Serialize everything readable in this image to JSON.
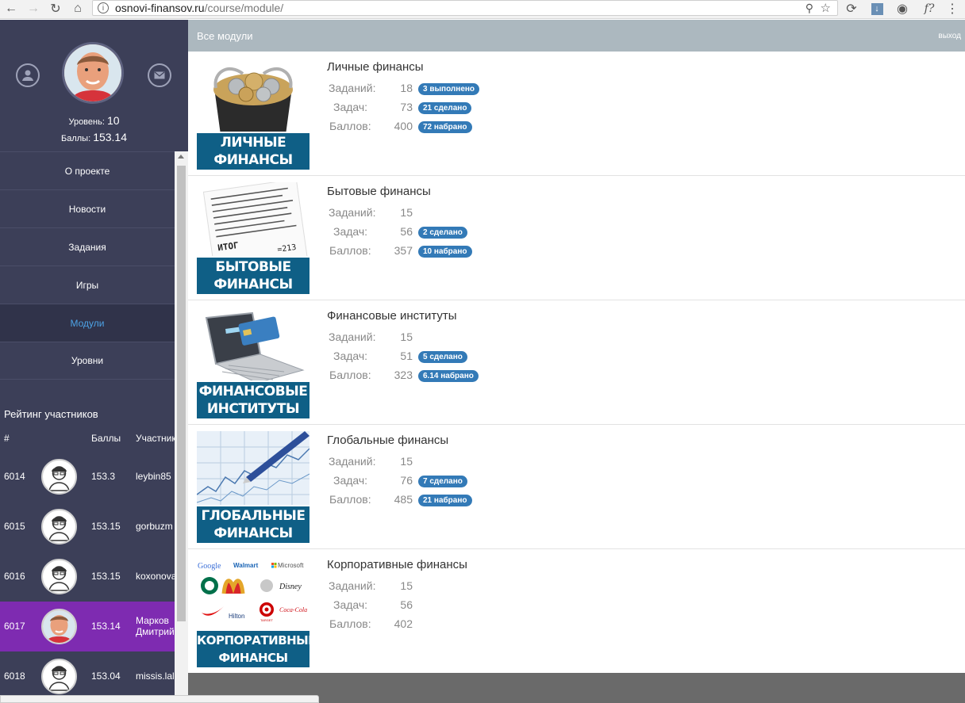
{
  "browser": {
    "url_host": "osnovi-finansov.ru",
    "url_path": "/course/module/",
    "ext_label": "f?"
  },
  "sidebar": {
    "level_label": "Уровень:",
    "level_value": "10",
    "points_label": "Баллы:",
    "points_value": "153.14",
    "menu": [
      {
        "label": "О проекте"
      },
      {
        "label": "Новости"
      },
      {
        "label": "Задания"
      },
      {
        "label": "Игры"
      },
      {
        "label": "Модули"
      },
      {
        "label": "Уровни"
      }
    ],
    "active_menu": "Модули",
    "rating_title": "Рейтинг участников",
    "rating_headers": [
      "#",
      "Баллы",
      "Участник"
    ],
    "rating_rows": [
      {
        "rank": "6014",
        "points": "153.3",
        "name": "leybin85"
      },
      {
        "rank": "6015",
        "points": "153.15",
        "name": "gorbuzm"
      },
      {
        "rank": "6016",
        "points": "153.15",
        "name": "koxonova"
      },
      {
        "rank": "6017",
        "points": "153.14",
        "name": "Марков Дмитрий"
      },
      {
        "rank": "6018",
        "points": "153.04",
        "name": "missis.lal"
      }
    ]
  },
  "topbar": {
    "title": "Все модули",
    "exit": "выход"
  },
  "modules": [
    {
      "title": "Личные финансы",
      "caption": [
        "ЛИЧНЫЕ",
        "ФИНАНСЫ"
      ],
      "tasks_label": "Заданий:",
      "tasks": "18",
      "tasks_badge": "3 выполнено",
      "problems_label": "Задач:",
      "problems": "73",
      "problems_badge": "21 сделано",
      "points_label": "Баллов:",
      "points": "400",
      "points_badge": "72 набрано"
    },
    {
      "title": "Бытовые финансы",
      "caption": [
        "БЫТОВЫЕ",
        "ФИНАНСЫ"
      ],
      "tasks_label": "Заданий:",
      "tasks": "15",
      "tasks_badge": "",
      "problems_label": "Задач:",
      "problems": "56",
      "problems_badge": "2 сделано",
      "points_label": "Баллов:",
      "points": "357",
      "points_badge": "10 набрано"
    },
    {
      "title": "Финансовые институты",
      "caption": [
        "ФИНАНСОВЫЕ",
        "ИНСТИТУТЫ"
      ],
      "tasks_label": "Заданий:",
      "tasks": "15",
      "tasks_badge": "",
      "problems_label": "Задач:",
      "problems": "51",
      "problems_badge": "5 сделано",
      "points_label": "Баллов:",
      "points": "323",
      "points_badge": "6.14 набрано"
    },
    {
      "title": "Глобальные финансы",
      "caption": [
        "ГЛОБАЛЬНЫЕ",
        "ФИНАНСЫ"
      ],
      "tasks_label": "Заданий:",
      "tasks": "15",
      "tasks_badge": "",
      "problems_label": "Задач:",
      "problems": "76",
      "problems_badge": "7 сделано",
      "points_label": "Баллов:",
      "points": "485",
      "points_badge": "21 набрано"
    },
    {
      "title": "Корпоративные финансы",
      "caption": [
        "КОРПОРАТИВНЫЕ",
        "ФИНАНСЫ"
      ],
      "tasks_label": "Заданий:",
      "tasks": "15",
      "tasks_badge": "",
      "problems_label": "Задач:",
      "problems": "56",
      "problems_badge": "",
      "points_label": "Баллов:",
      "points": "402",
      "points_badge": "",
      "logos": [
        "Google",
        "Walmart",
        "Microsoft",
        "Hilton",
        "TARGET",
        "Coca-Cola"
      ]
    }
  ]
}
